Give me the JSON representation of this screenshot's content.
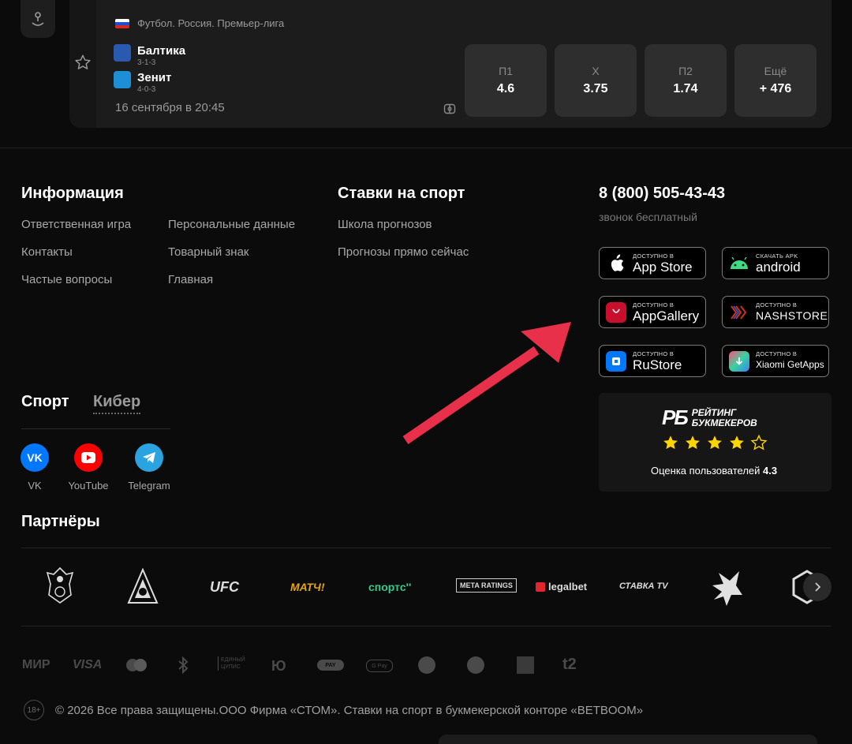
{
  "match": {
    "league": "Футбол. Россия. Премьер-лига",
    "team1": {
      "name": "Балтика",
      "record": "3-1-3"
    },
    "team2": {
      "name": "Зенит",
      "record": "4-0-3"
    },
    "datetime": "16 сентября в 20:45",
    "odds": [
      {
        "label": "П1",
        "value": "4.6"
      },
      {
        "label": "X",
        "value": "3.75"
      },
      {
        "label": "П2",
        "value": "1.74"
      },
      {
        "label": "Ещё",
        "value": "+ 476"
      }
    ]
  },
  "footer": {
    "info": {
      "title": "Информация",
      "col1": [
        "Ответственная игра",
        "Контакты",
        "Частые вопросы"
      ],
      "col2": [
        "Персональные данные",
        "Товарный знак",
        "Главная"
      ]
    },
    "bets": {
      "title": "Ставки на спорт",
      "links": [
        "Школа прогнозов",
        "Прогнозы прямо сейчас"
      ]
    },
    "contact": {
      "phone": "8 (800) 505-43-43",
      "note": "звонок бесплатный"
    },
    "stores": [
      {
        "small": "ДОСТУПНО В",
        "big": "App Store",
        "icon": "apple-icon"
      },
      {
        "small": "СКАЧАТЬ APK",
        "big": "android",
        "icon": "android-icon"
      },
      {
        "small": "ДОСТУПНО В",
        "big": "AppGallery",
        "icon": "huawei-icon"
      },
      {
        "small": "ДОСТУПНО В",
        "big": "NASHSTORE",
        "icon": "nashstore-icon"
      },
      {
        "small": "ДОСТУПНО В",
        "big": "RuStore",
        "icon": "rustore-icon"
      },
      {
        "small": "ДОСТУПНО В",
        "big": "Xiaomi GetApps",
        "icon": "xiaomi-getapps-icon"
      }
    ],
    "rating": {
      "logo": "РБ",
      "logo_line1": "РЕЙТИНГ",
      "logo_line2": "БУКМЕКЕРОВ",
      "stars": 4,
      "stars_max": 5,
      "label": "Оценка пользователей",
      "score": "4.3"
    },
    "tabs": [
      "Спорт",
      "Кибер"
    ],
    "social": [
      {
        "name": "VK",
        "color": "#0077ff"
      },
      {
        "name": "YouTube",
        "color": "#ff0000"
      },
      {
        "name": "Telegram",
        "color": "#2aa3e0"
      }
    ],
    "partners_title": "Партнёры",
    "partners": [
      "РФС",
      "Локомотив",
      "UFC",
      "МАТЧ!",
      "спортс''",
      "META RATINGS",
      "legalbet",
      "СТАВКА TV",
      "Team Spirit",
      "Cloud"
    ],
    "payments": [
      "МИР",
      "VISA",
      "mastercard",
      "bluetooth",
      "ЕДИНЫЙ ЦУПИС",
      "Ю",
      "PAY",
      "G Pay",
      "SBP",
      "Б",
      "МТС",
      "t2"
    ],
    "age": "18+",
    "copyright": "© 2026 Все права защищены.ООО Фирма «СТОМ». Ставки на спорт в букмекерской конторе «BETBOOM»"
  },
  "colors": {
    "arrow": "#e8304a",
    "star": "#ffd500"
  }
}
